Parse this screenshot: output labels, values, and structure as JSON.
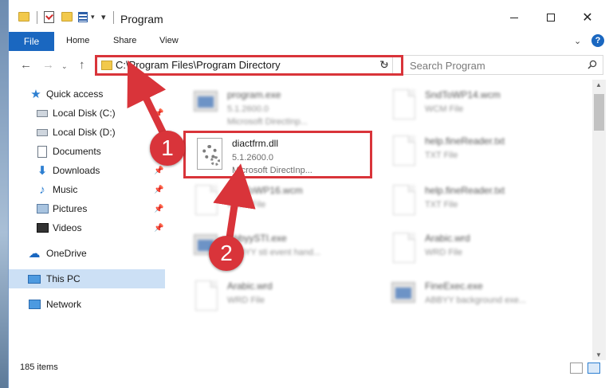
{
  "window": {
    "title": "Program",
    "close_glyph": "✕"
  },
  "ribbon": {
    "file": "File",
    "tabs": [
      "Home",
      "Share",
      "View"
    ],
    "help": "?"
  },
  "nav": {
    "back": "←",
    "forward": "→",
    "up": "↑",
    "address": "C:\\Program Files\\Program Directory",
    "refresh": "↻",
    "search_placeholder": "Search Program"
  },
  "sidebar": {
    "items": [
      {
        "label": "Quick access",
        "icon": "star-icon"
      },
      {
        "label": "Local Disk (C:)",
        "icon": "disk-icon"
      },
      {
        "label": "Local Disk (D:)",
        "icon": "disk-icon"
      },
      {
        "label": "Documents",
        "icon": "document-icon"
      },
      {
        "label": "Downloads",
        "icon": "download-icon"
      },
      {
        "label": "Music",
        "icon": "music-icon"
      },
      {
        "label": "Pictures",
        "icon": "pictures-icon"
      },
      {
        "label": "Videos",
        "icon": "videos-icon"
      },
      {
        "label": "OneDrive",
        "icon": "cloud-icon"
      },
      {
        "label": "This PC",
        "icon": "computer-icon"
      },
      {
        "label": "Network",
        "icon": "network-icon"
      }
    ]
  },
  "files": [
    {
      "name": "program.exe",
      "line2": "5.1.2600.0",
      "line3": "Microsoft DirectInp...",
      "kind": "exe"
    },
    {
      "name": "SndToWP14.wcm",
      "line2": "WCM File",
      "line3": "",
      "kind": "page"
    },
    {
      "name": "diactfrm.dll",
      "line2": "5.1.2600.0",
      "line3": "Microsoft DirectInp...",
      "kind": "dll"
    },
    {
      "name": "help.fineReader.txt",
      "line2": "TXT File",
      "line3": "",
      "kind": "page"
    },
    {
      "name": "SndToWP16.wcm",
      "line2": "WCM File",
      "line3": "",
      "kind": "page"
    },
    {
      "name": "help.fineReader.txt",
      "line2": "TXT File",
      "line3": "",
      "kind": "page"
    },
    {
      "name": "AbbyySTI.exe",
      "line2": "ABBYY sti event hand...",
      "line3": "",
      "kind": "exe"
    },
    {
      "name": "Arabic.wrd",
      "line2": "WRD File",
      "line3": "",
      "kind": "page"
    },
    {
      "name": "Arabic.wrd",
      "line2": "WRD File",
      "line3": "",
      "kind": "page"
    },
    {
      "name": "FineExec.exe",
      "line2": "ABBYY background exe...",
      "line3": "",
      "kind": "exe"
    }
  ],
  "status": {
    "count": "185 items"
  },
  "annotations": {
    "step1": "1",
    "step2": "2",
    "color": "#d9343a"
  }
}
